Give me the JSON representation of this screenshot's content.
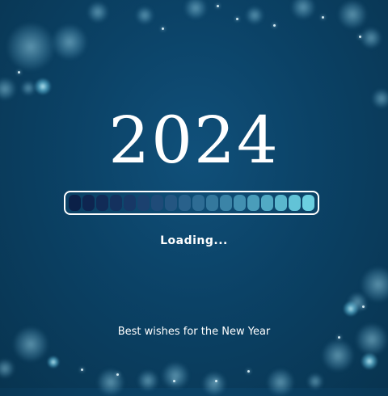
{
  "year": "2024",
  "loading_text": "Loading...",
  "wishes_text": "Best wishes for the New Year",
  "progress": {
    "segments": 18,
    "colors": [
      "#0b2048",
      "#0e2550",
      "#112b57",
      "#14315e",
      "#173866",
      "#1b416f",
      "#1f4b78",
      "#245681",
      "#29618b",
      "#2e6c94",
      "#34789d",
      "#3b84a7",
      "#4290b1",
      "#4a9dba",
      "#52aac4",
      "#5ab7cd",
      "#62c3d7",
      "#6bcfe0"
    ]
  },
  "colors": {
    "background": "#0b4266",
    "text": "#ffffff"
  }
}
